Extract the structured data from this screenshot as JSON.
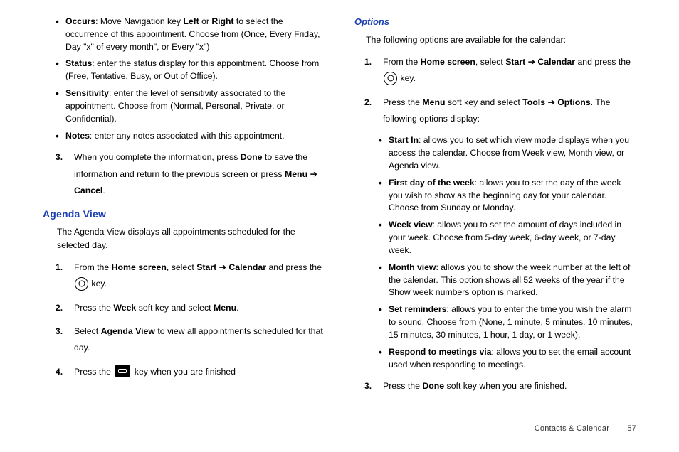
{
  "col1": {
    "bullets_top": [
      {
        "label": "Occurs",
        "rest": ": Move Navigation key ",
        "b2": "Left",
        "mid": " or ",
        "b3": "Right",
        "rest2": " to select the occurrence of this appointment. Choose from (Once, Every Friday, Day \"x\" of every month\", or Every \"x\")"
      },
      {
        "label": "Status",
        "rest": ": enter the status display for this appointment. Choose from (Free, Tentative, Busy, or Out of Office)."
      },
      {
        "label": "Sensitivity",
        "rest": ": enter the level of sensitivity associated to the appointment. Choose from (Normal, Personal, Private, or Confidential)."
      },
      {
        "label": "Notes",
        "rest": ": enter any notes associated with this appointment."
      }
    ],
    "step3_pre": "When you complete the information, press ",
    "step3_b1": "Done",
    "step3_mid": " to save the information and return to the previous screen or press ",
    "step3_b2": "Menu",
    "step3_arrow": " ➔ ",
    "step3_b3": "Cancel",
    "step3_end": ".",
    "h_agenda": "Agenda View",
    "agenda_para": "The Agenda View displays all appointments scheduled for the selected day.",
    "s1_a": "From the ",
    "s1_b": "Home screen",
    "s1_c": ", select ",
    "s1_d": "Start",
    "s1_e": " ➔ ",
    "s1_f": "Calendar",
    "s1_g": " and press the ",
    "s1_h": " key.",
    "s2_a": "Press the ",
    "s2_b": "Week",
    "s2_c": " soft key and select ",
    "s2_d": "Menu",
    "s2_e": ".",
    "s3_a": "Select ",
    "s3_b": "Agenda View",
    "s3_c": " to view all appointments scheduled for that day.",
    "s4_a": "Press the ",
    "s4_b": " key when you are finished"
  },
  "col2": {
    "h_options": "Options",
    "opt_para": "The following options are available for the calendar:",
    "s1_a": "From the ",
    "s1_b": "Home screen",
    "s1_c": ", select ",
    "s1_d": "Start",
    "s1_e": " ➔ ",
    "s1_f": "Calendar",
    "s1_g": " and press the ",
    "s1_h": " key.",
    "s2_a": "Press the ",
    "s2_b": "Menu",
    "s2_c": " soft key and select ",
    "s2_d": "Tools",
    "s2_e": " ➔ ",
    "s2_f": "Options",
    "s2_g": ". The following options display:",
    "bullets": [
      {
        "label": "Start In",
        "rest": ": allows you to set which view mode displays when you access the calendar. Choose from Week view, Month view, or Agenda view."
      },
      {
        "label": "First day of the week",
        "rest": ": allows you to set the day of the week you wish to show as the beginning day for your calendar. Choose from Sunday or Monday."
      },
      {
        "label": "Week view",
        "rest": ": allows you to set the amount of days included in your week. Choose from 5-day week, 6-day week, or 7-day week."
      },
      {
        "label": "Month view",
        "rest": ": allows you to show the week number at the left of the calendar. This option shows all 52 weeks of the year if the Show week numbers option is marked."
      },
      {
        "label": "Set reminders",
        "rest": ": allows you to enter the time you wish the alarm to sound. Choose from (None, 1 minute, 5 minutes, 10 minutes, 15 minutes, 30 minutes, 1 hour, 1 day, or 1 week)."
      },
      {
        "label": "Respond to meetings via",
        "rest": ": allows you to set the email account used when responding to meetings."
      }
    ],
    "s3_a": "Press the ",
    "s3_b": "Done",
    "s3_c": " soft key when you are finished."
  },
  "footer": {
    "section": "Contacts & Calendar",
    "page": "57"
  }
}
